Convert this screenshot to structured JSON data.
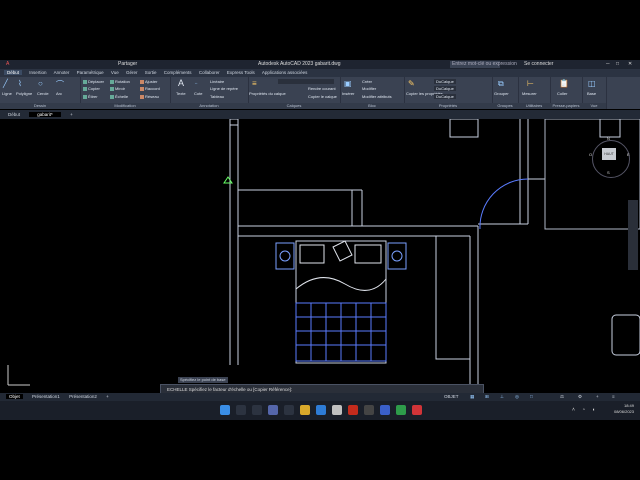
{
  "titlebar": {
    "title": "Autodesk AutoCAD 2023    gabarit.dwg",
    "share": "Partager",
    "search_placeholder": "Entrez mot-clé ou expression",
    "signin": "Se connecter"
  },
  "ribbon_tabs": [
    "Début",
    "Insertion",
    "Annoter",
    "Paramétrique",
    "Vue",
    "Gérer",
    "Sortie",
    "Compléments",
    "Collaborer",
    "Express Tools",
    "Applications associées"
  ],
  "draw_panel": {
    "label": "Dessin",
    "items": [
      "Ligne",
      "Polyligne",
      "Cercle",
      "Arc"
    ]
  },
  "modify_panel": {
    "label": "Modification",
    "items": [
      "Déplacer",
      "Rotation",
      "Ajuster",
      "Copier",
      "Miroir",
      "Raccord",
      "Étirer",
      "Échelle",
      "Réseau"
    ]
  },
  "annotation_panel": {
    "label": "Annotation",
    "items": [
      "Texte",
      "Cote",
      "Linéaire",
      "Ligne de repère",
      "Tableau"
    ]
  },
  "layers_panel": {
    "label": "Calques",
    "items": [
      "Propriétés du calque",
      "Rendre courant",
      "Copier le calque"
    ]
  },
  "block_panel": {
    "label": "Bloc",
    "items": [
      "Insérer",
      "Créer",
      "Modifier",
      "Modifier attributs"
    ]
  },
  "properties_panel": {
    "label": "Propriétés",
    "items": [
      "Copier les propriétés",
      "DuCalque",
      "DuCalque",
      "DuCalque"
    ]
  },
  "groups_panel": {
    "label": "Groupes",
    "items": [
      "Grouper"
    ]
  },
  "utilities_panel": {
    "label": "Utilitaires",
    "items": [
      "Mesurer"
    ]
  },
  "clipboard_panel": {
    "label": "Presse-papiers",
    "items": [
      "Coller"
    ]
  },
  "view_panel": {
    "label": "Vue",
    "items": [
      "Base"
    ]
  },
  "doc_tabs": [
    "Début",
    "gabarit*"
  ],
  "viewcube": {
    "face": "HAUT",
    "n": "N",
    "s": "S",
    "e": "E",
    "w": "O"
  },
  "command": {
    "hint": "Spécifiez le point de base",
    "line": "ECHELLE Spécifiez le facteur d'échelle ou [Copier Référence]:"
  },
  "layout_tabs": [
    "Objet",
    "Présentation1",
    "Présentation2"
  ],
  "status_right": "OBJET",
  "clock": {
    "time": "18:49",
    "date": "08/06/2023"
  }
}
